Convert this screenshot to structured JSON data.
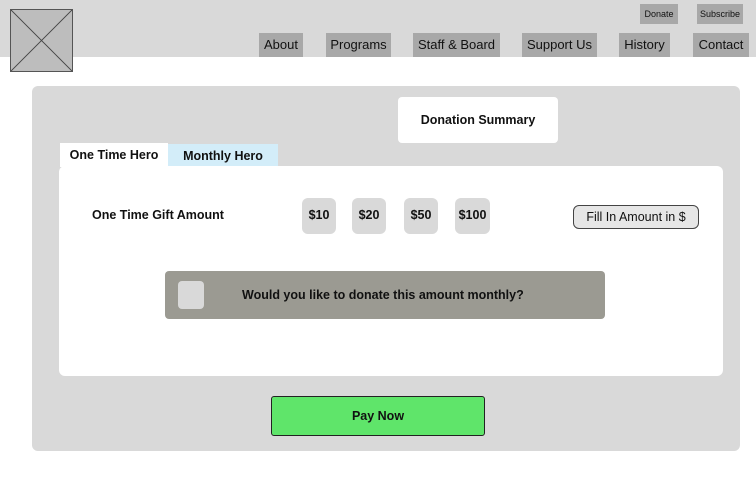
{
  "header": {
    "logo_icon": "placeholder-image-icon",
    "top_links": {
      "donate": "Donate",
      "subscribe": "Subscribe"
    },
    "nav": {
      "about": "About",
      "programs": "Programs",
      "staff_board": "Staff & Board",
      "support_us": "Support Us",
      "history": "History",
      "contact": "Contact"
    }
  },
  "main": {
    "summary_button": "Donation Summary",
    "tabs": [
      {
        "label": "One Time Hero",
        "active": true
      },
      {
        "label": "Monthly Hero",
        "active": false
      }
    ],
    "gift_amount_label": "One Time Gift Amount",
    "amounts": [
      "$10",
      "$20",
      "$50",
      "$100"
    ],
    "custom_amount_placeholder": "Fill In Amount in $",
    "monthly_question": "Would you like to donate this amount monthly?",
    "pay_button": "Pay Now"
  },
  "colors": {
    "header_bg": "#d9d9d9",
    "nav_button": "#a8a8a8",
    "monthly_tab": "#d3edf9",
    "monthly_bar": "#9b9a92",
    "pay_button": "#5fe56a"
  }
}
